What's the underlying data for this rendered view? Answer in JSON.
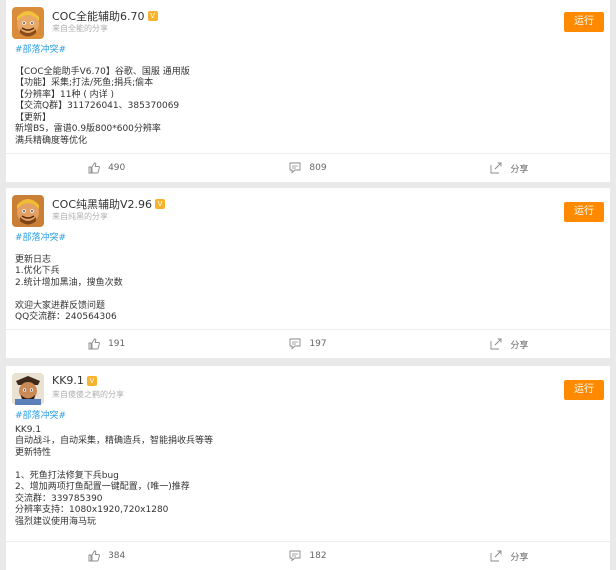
{
  "posts": [
    {
      "app_name": "COC全能辅助6.70",
      "vip_badge": "V",
      "source": "来自全能的分享",
      "run_label": "运行",
      "hashtag": "#部落冲突#",
      "content": "【COC全能助手V6.70】谷歌、国服 通用版\n【功能】采集;打法/死鱼;捐兵;偷本\n【分辨率】11种 ( 内详 )\n【交流Q群】311726041、385370069\n【更新】\n新增BS，雷谱0.9版800*600分辨率\n满兵精确度等优化",
      "likes": "490",
      "comments": "809",
      "share_label": "分享",
      "avatar_icon": "barbarian-avatar",
      "accent": "#ff8a00"
    },
    {
      "app_name": "COC纯黑辅助V2.96",
      "vip_badge": "V",
      "source": "来自纯黑的分享",
      "run_label": "运行",
      "hashtag": "#部落冲突#",
      "content": "更新日志\n1.优化下兵\n2.统计增加黑油，搜鱼次数\n\n欢迎大家进群反馈问题\nQQ交流群：240564306",
      "likes": "191",
      "comments": "197",
      "share_label": "分享",
      "avatar_icon": "barbarian-avatar"
    },
    {
      "app_name": "KK9.1",
      "vip_badge": "V",
      "source": "来自傻傻之鹤的分享",
      "run_label": "运行",
      "hashtag": "#部落冲突#",
      "content": "KK9.1\n自动战斗，自动采集，精确造兵，智能捐收兵等等\n更新特性\n\n1、死鱼打法修复下兵bug\n2、增加两项打鱼配置一键配置，(唯一)推荐\n交流群：339785390\n分辨率支持：1080x1920,720x1280\n强烈建议使用海马玩",
      "likes": "384",
      "comments": "182",
      "share_label": "分享",
      "avatar_icon": "hog-rider-avatar"
    }
  ]
}
